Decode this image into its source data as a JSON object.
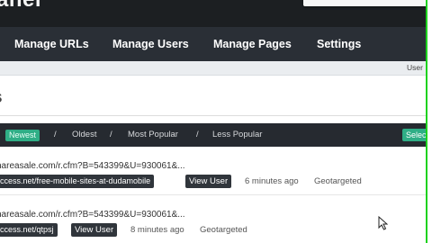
{
  "header": {
    "logo": "anel"
  },
  "nav": {
    "items": [
      {
        "label": "Manage URLs"
      },
      {
        "label": "Manage Users"
      },
      {
        "label": "Manage Pages"
      },
      {
        "label": "Settings"
      }
    ]
  },
  "subbar": {
    "user_label": "User"
  },
  "page": {
    "heading": "s"
  },
  "sortbar": {
    "active": "Newest",
    "links": [
      "Oldest",
      "Most Popular",
      "Less Popular"
    ],
    "separator": "/",
    "select_label": "Selec"
  },
  "rows": [
    {
      "url": "hareasale.com/r.cfm?B=543399&U=930061&...",
      "short": "ccess.net/free-mobile-sites-at-dudamobile",
      "view_label": "View User",
      "time": "6 minutes ago",
      "tag": "Geotargeted"
    },
    {
      "url": "hareasale.com/r.cfm?B=543399&U=930061&...",
      "short": "ccess.net/qtpsj",
      "view_label": "View User",
      "time": "8 minutes ago",
      "tag": "Geotargeted"
    }
  ],
  "colors": {
    "header_bg": "#1c1f22",
    "nav_bg": "#2a2f36",
    "accent_green": "#2fae86",
    "edge_green": "#1ed21e"
  }
}
